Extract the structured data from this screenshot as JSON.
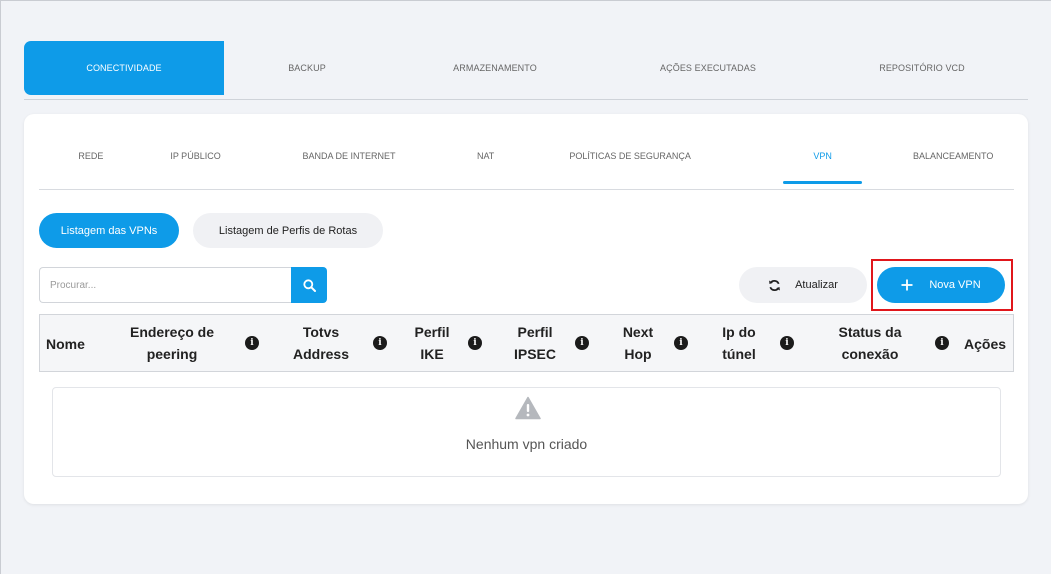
{
  "top_tabs": [
    "CONECTIVIDADE",
    "BACKUP",
    "ARMAZENAMENTO",
    "AÇÕES EXECUTADAS",
    "REPOSITÓRIO VCD"
  ],
  "sub_tabs": [
    "REDE",
    "IP PÚBLICO",
    "BANDA DE INTERNET",
    "NAT",
    "POLÍTICAS DE SEGURANÇA",
    "VPN",
    "BALANCEAMENTO"
  ],
  "pills": {
    "list_vpns": "Listagem das VPNs",
    "list_routes": "Listagem de Perfis de Rotas"
  },
  "search": {
    "placeholder": "Procurar..."
  },
  "actions": {
    "refresh": "Atualizar",
    "new_vpn": "Nova VPN"
  },
  "table": {
    "headers": {
      "name": "Nome",
      "peering_1": "Endereço de",
      "peering_2": "peering",
      "totvs_1": "Totvs",
      "totvs_2": "Address",
      "ike_1": "Perfil",
      "ike_2": "IKE",
      "ipsec_1": "Perfil",
      "ipsec_2": "IPSEC",
      "hop_1": "Next",
      "hop_2": "Hop",
      "tunnel_1": "Ip do",
      "tunnel_2": "túnel",
      "status_1": "Status da",
      "status_2": "conexão",
      "actions": "Ações"
    },
    "info_glyph": "i"
  },
  "empty": {
    "message": "Nenhum vpn criado"
  },
  "colors": {
    "accent": "#0e9be8",
    "highlight": "#e0161b"
  }
}
